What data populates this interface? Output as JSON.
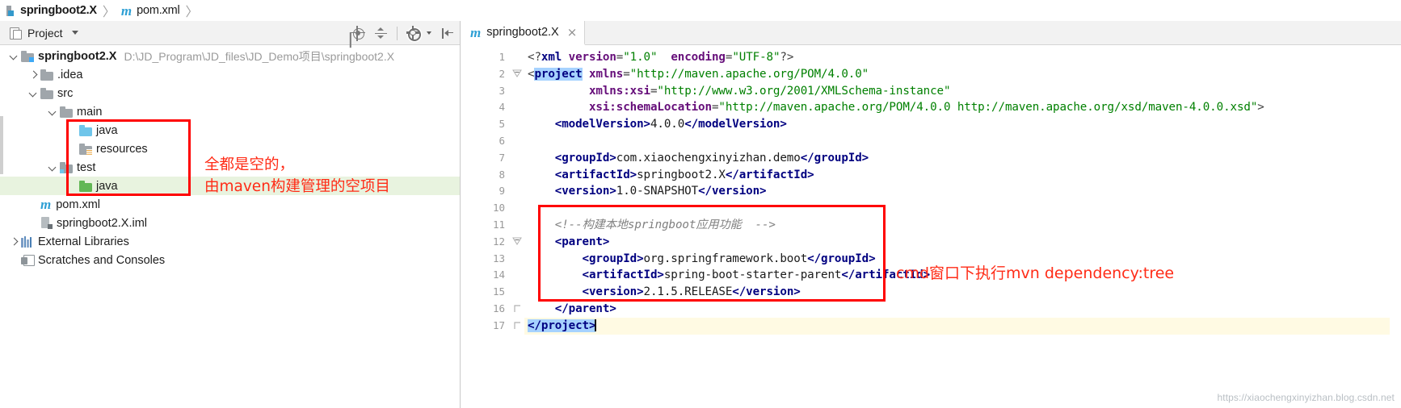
{
  "breadcrumb": {
    "items": [
      {
        "label": "springboot2.X",
        "icon": "module-icon",
        "bold": true
      },
      {
        "label": "pom.xml",
        "icon": "maven-m-icon",
        "bold": false
      }
    ],
    "separator": "〉"
  },
  "project_panel": {
    "title": "Project",
    "dropdown_caret": "▾",
    "tools": [
      {
        "name": "locate-in-tree-icon",
        "tooltip": "Select Opened File"
      },
      {
        "name": "collapse-all-icon",
        "tooltip": "Collapse All"
      },
      {
        "name": "gear-settings-icon",
        "tooltip": "Settings"
      },
      {
        "name": "hide-panel-icon",
        "tooltip": "Hide"
      }
    ],
    "tree": [
      {
        "level": 0,
        "arrow": "down",
        "icon": "module-folder",
        "label": "springboot2.X",
        "bold": true,
        "path": "D:\\JD_Program\\JD_files\\JD_Demo项目\\springboot2.X",
        "selected": false
      },
      {
        "level": 1,
        "arrow": "right",
        "icon": "folder-gray",
        "label": ".idea",
        "bold": false,
        "path": "",
        "selected": false
      },
      {
        "level": 1,
        "arrow": "down",
        "icon": "folder-gray",
        "label": "src",
        "bold": false,
        "path": "",
        "selected": false
      },
      {
        "level": 2,
        "arrow": "down",
        "icon": "folder-gray",
        "label": "main",
        "bold": false,
        "path": "",
        "selected": false
      },
      {
        "level": 3,
        "arrow": "none",
        "icon": "folder-blue",
        "label": "java",
        "bold": false,
        "path": "",
        "selected": false
      },
      {
        "level": 3,
        "arrow": "none",
        "icon": "folder-resources",
        "label": "resources",
        "bold": false,
        "path": "",
        "selected": false
      },
      {
        "level": 2,
        "arrow": "down",
        "icon": "folder-test",
        "label": "test",
        "bold": false,
        "path": "",
        "selected": false
      },
      {
        "level": 3,
        "arrow": "none",
        "icon": "folder-green",
        "label": "java",
        "bold": false,
        "path": "",
        "selected": true
      },
      {
        "level": 1,
        "arrow": "none",
        "icon": "maven-m-icon",
        "label": "pom.xml",
        "bold": false,
        "path": "",
        "selected": false
      },
      {
        "level": 1,
        "arrow": "none",
        "icon": "iml-file-icon",
        "label": "springboot2.X.iml",
        "bold": false,
        "path": "",
        "selected": false
      },
      {
        "level": 0,
        "arrow": "right",
        "icon": "libraries-icon",
        "label": "External Libraries",
        "bold": false,
        "path": "",
        "selected": false
      },
      {
        "level": 0,
        "arrow": "none",
        "icon": "scratches-icon",
        "label": "Scratches and Consoles",
        "bold": false,
        "path": "",
        "selected": false
      }
    ]
  },
  "annotations": {
    "color": "#ff0000",
    "text_color": "#ff2b16",
    "tree_note_line1": "全都是空的，",
    "tree_note_line2": "由maven构建管理的空项目",
    "editor_note": "cmd窗口下执行mvn dependency:tree"
  },
  "editor": {
    "tabs": [
      {
        "label": "springboot2.X",
        "icon": "maven-m-icon",
        "close": "×",
        "active": true
      }
    ],
    "line_numbers": [
      "1",
      "2",
      "3",
      "4",
      "5",
      "6",
      "7",
      "8",
      "9",
      "10",
      "11",
      "12",
      "13",
      "14",
      "15",
      "16",
      "17"
    ],
    "current_line": 17,
    "code_lines": [
      {
        "n": 1,
        "segments": [
          {
            "t": "&lt;?",
            "c": "tok-brk"
          },
          {
            "t": "xml",
            "c": "tok-tag"
          },
          {
            "t": " ",
            "c": "tok-txt"
          },
          {
            "t": "version",
            "c": "tok-attr"
          },
          {
            "t": "=",
            "c": "tok-brk"
          },
          {
            "t": "\"1.0\"",
            "c": "tok-str"
          },
          {
            "t": "  ",
            "c": "tok-txt"
          },
          {
            "t": "encoding",
            "c": "tok-attr"
          },
          {
            "t": "=",
            "c": "tok-brk"
          },
          {
            "t": "\"UTF-8\"",
            "c": "tok-str"
          },
          {
            "t": "?&gt;",
            "c": "tok-brk"
          }
        ]
      },
      {
        "n": 2,
        "segments": [
          {
            "t": "&lt;",
            "c": "tok-brk"
          },
          {
            "t": "project",
            "c": "tok-tag hl-sel"
          },
          {
            "t": " ",
            "c": "tok-txt"
          },
          {
            "t": "xmlns",
            "c": "tok-attr"
          },
          {
            "t": "=",
            "c": "tok-brk"
          },
          {
            "t": "\"http://maven.apache.org/POM/4.0.0\"",
            "c": "tok-str"
          }
        ]
      },
      {
        "n": 3,
        "segments": [
          {
            "t": "         ",
            "c": "tok-txt"
          },
          {
            "t": "xmlns:xsi",
            "c": "tok-attr"
          },
          {
            "t": "=",
            "c": "tok-brk"
          },
          {
            "t": "\"http://www.w3.org/2001/XMLSchema-instance\"",
            "c": "tok-str"
          }
        ]
      },
      {
        "n": 4,
        "segments": [
          {
            "t": "         ",
            "c": "tok-txt"
          },
          {
            "t": "xsi:schemaLocation",
            "c": "tok-attr"
          },
          {
            "t": "=",
            "c": "tok-brk"
          },
          {
            "t": "\"http://maven.apache.org/POM/4.0.0 http://maven.apache.org/xsd/maven-4.0.0.xsd\"",
            "c": "tok-str"
          },
          {
            "t": "&gt;",
            "c": "tok-brk"
          }
        ]
      },
      {
        "n": 5,
        "segments": [
          {
            "t": "    ",
            "c": "tok-txt"
          },
          {
            "t": "&lt;modelVersion&gt;",
            "c": "tok-tag"
          },
          {
            "t": "4.0.0",
            "c": "tok-txt"
          },
          {
            "t": "&lt;/modelVersion&gt;",
            "c": "tok-tag"
          }
        ]
      },
      {
        "n": 6,
        "segments": []
      },
      {
        "n": 7,
        "segments": [
          {
            "t": "    ",
            "c": "tok-txt"
          },
          {
            "t": "&lt;groupId&gt;",
            "c": "tok-tag"
          },
          {
            "t": "com.xiaochengxinyizhan.demo",
            "c": "tok-txt"
          },
          {
            "t": "&lt;/groupId&gt;",
            "c": "tok-tag"
          }
        ]
      },
      {
        "n": 8,
        "segments": [
          {
            "t": "    ",
            "c": "tok-txt"
          },
          {
            "t": "&lt;artifactId&gt;",
            "c": "tok-tag"
          },
          {
            "t": "springboot2.X",
            "c": "tok-txt"
          },
          {
            "t": "&lt;/artifactId&gt;",
            "c": "tok-tag"
          }
        ]
      },
      {
        "n": 9,
        "segments": [
          {
            "t": "    ",
            "c": "tok-txt"
          },
          {
            "t": "&lt;version&gt;",
            "c": "tok-tag"
          },
          {
            "t": "1.0-SNAPSHOT",
            "c": "tok-txt"
          },
          {
            "t": "&lt;/version&gt;",
            "c": "tok-tag"
          }
        ]
      },
      {
        "n": 10,
        "segments": []
      },
      {
        "n": 11,
        "segments": [
          {
            "t": "    ",
            "c": "tok-txt"
          },
          {
            "t": "&lt;!--构建本地springboot应用功能  --&gt;",
            "c": "tok-cmt"
          }
        ]
      },
      {
        "n": 12,
        "segments": [
          {
            "t": "    ",
            "c": "tok-txt"
          },
          {
            "t": "&lt;parent&gt;",
            "c": "tok-tag"
          }
        ]
      },
      {
        "n": 13,
        "segments": [
          {
            "t": "        ",
            "c": "tok-txt"
          },
          {
            "t": "&lt;groupId&gt;",
            "c": "tok-tag"
          },
          {
            "t": "org.springframework.boot",
            "c": "tok-txt"
          },
          {
            "t": "&lt;/groupId&gt;",
            "c": "tok-tag"
          }
        ]
      },
      {
        "n": 14,
        "segments": [
          {
            "t": "        ",
            "c": "tok-txt"
          },
          {
            "t": "&lt;artifactId&gt;",
            "c": "tok-tag"
          },
          {
            "t": "spring-boot-starter-parent",
            "c": "tok-txt"
          },
          {
            "t": "&lt;/artifactId&gt;",
            "c": "tok-tag"
          }
        ]
      },
      {
        "n": 15,
        "segments": [
          {
            "t": "        ",
            "c": "tok-txt"
          },
          {
            "t": "&lt;version&gt;",
            "c": "tok-tag"
          },
          {
            "t": "2.1.5.RELEASE",
            "c": "tok-txt"
          },
          {
            "t": "&lt;/version&gt;",
            "c": "tok-tag"
          }
        ]
      },
      {
        "n": 16,
        "segments": [
          {
            "t": "    ",
            "c": "tok-txt"
          },
          {
            "t": "&lt;/parent&gt;",
            "c": "tok-tag"
          }
        ]
      },
      {
        "n": 17,
        "segments": [
          {
            "t": "&lt;/project&gt;",
            "c": "tok-tag hl-sel"
          }
        ]
      }
    ]
  },
  "watermark": "https://xiaochengxinyizhan.blog.csdn.net"
}
